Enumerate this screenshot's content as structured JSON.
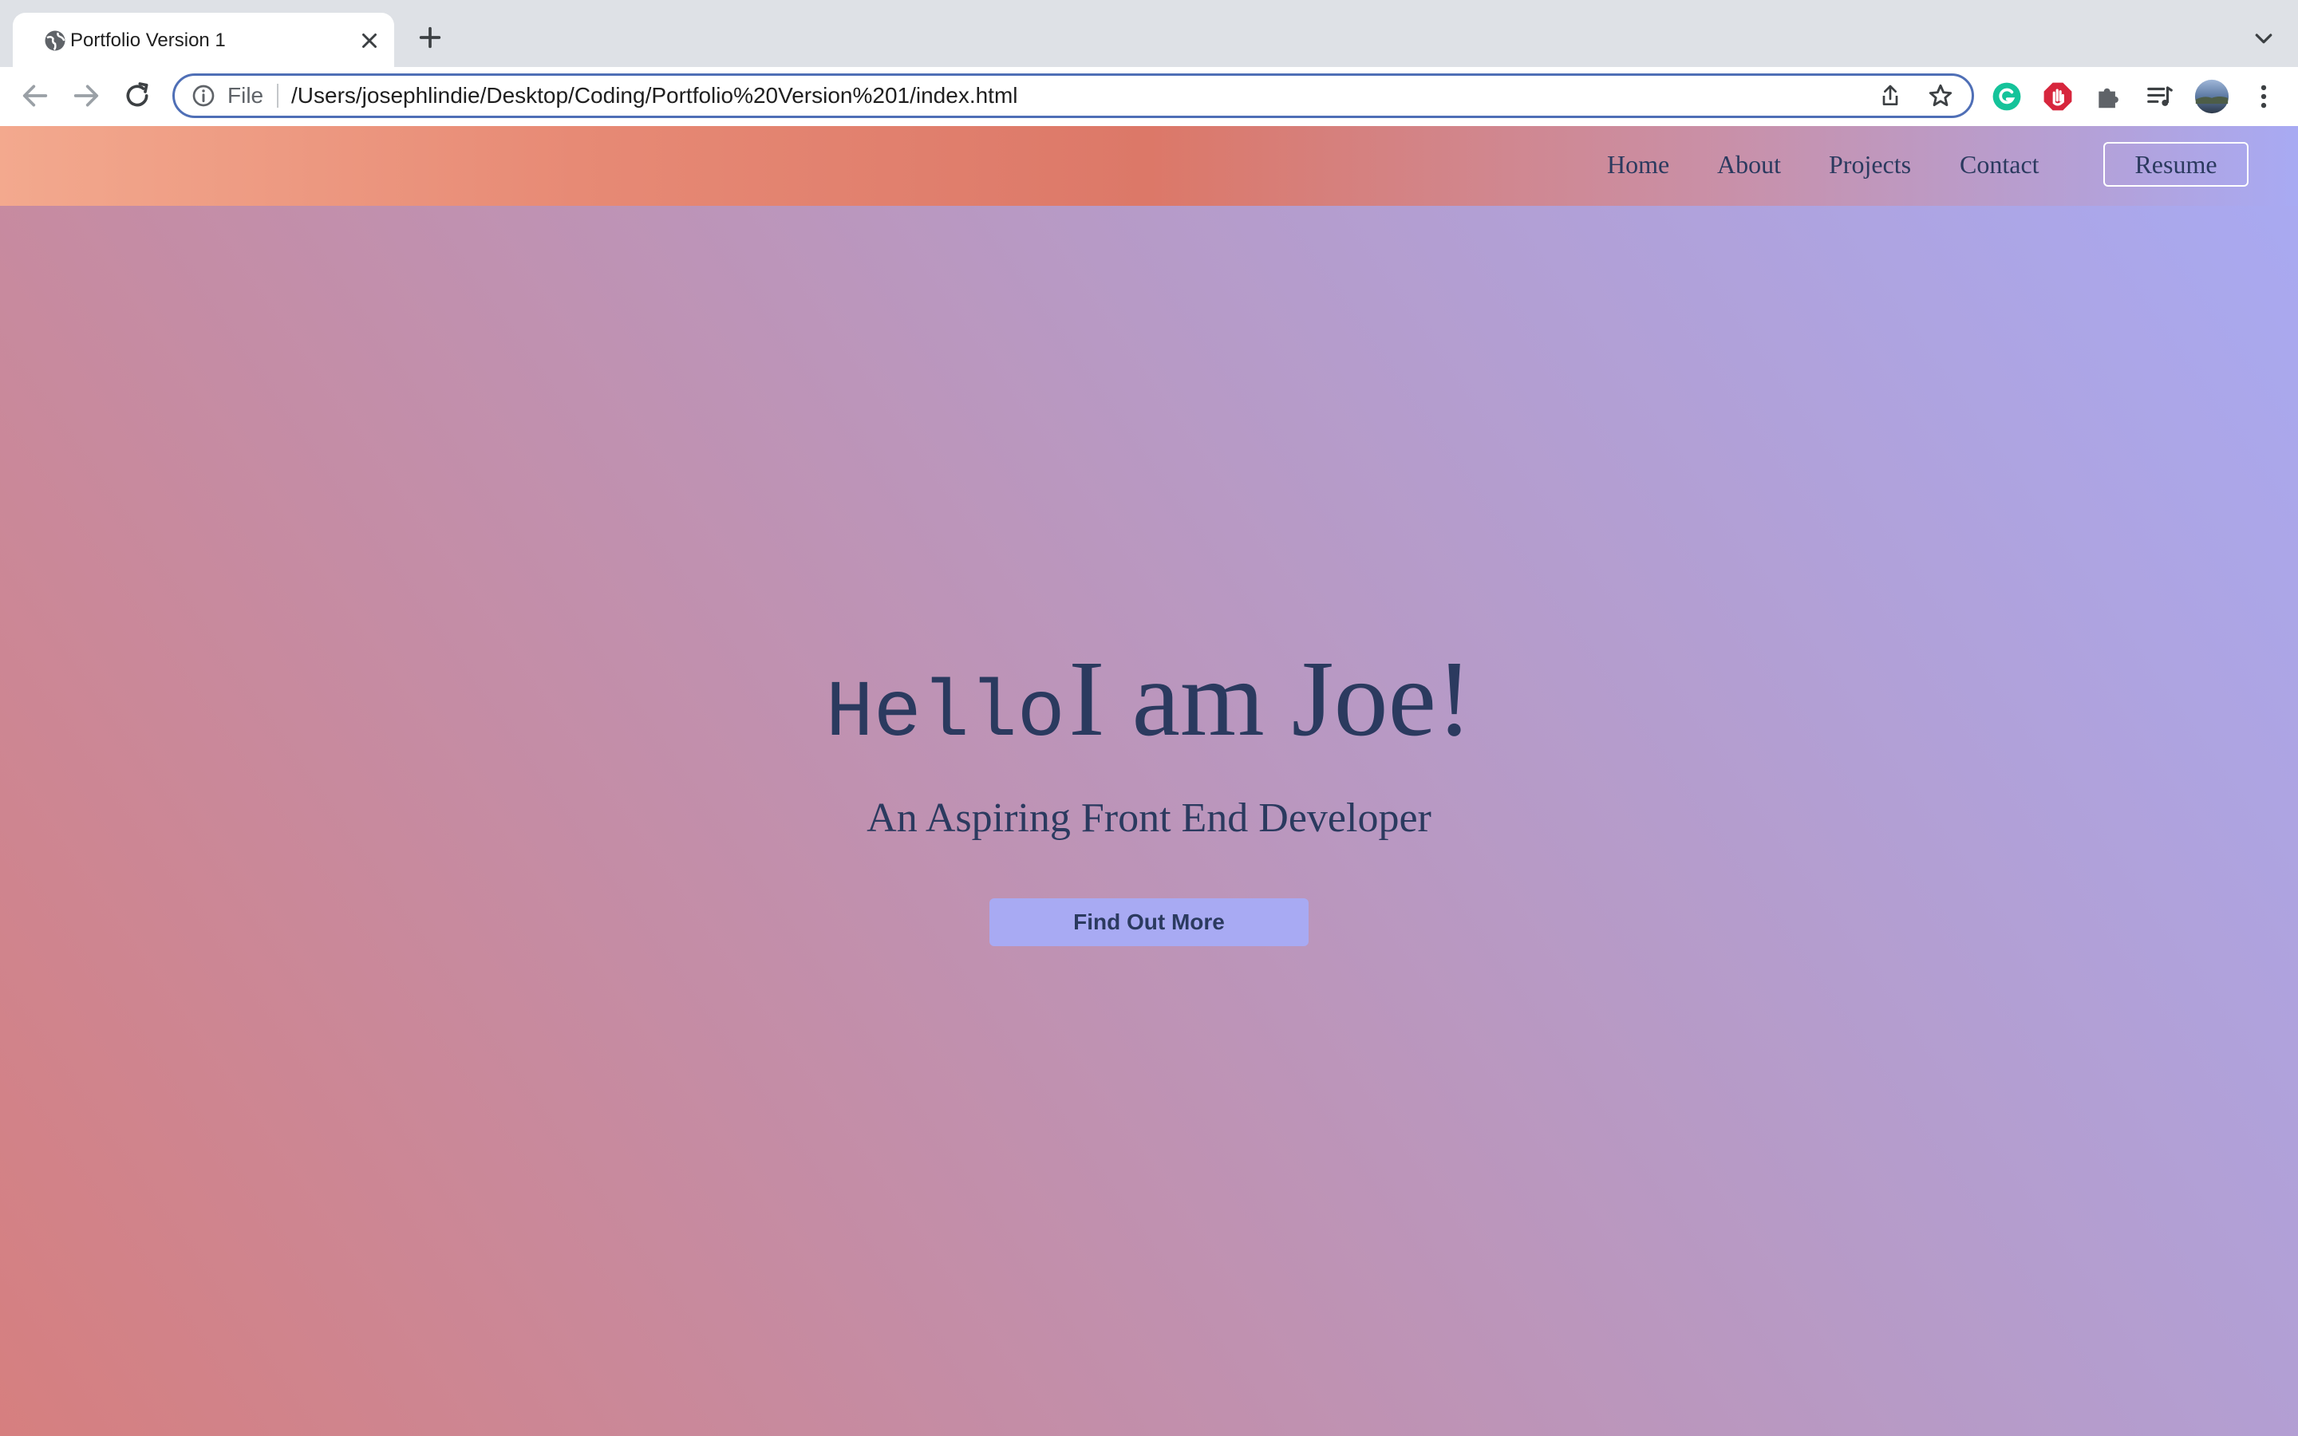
{
  "browser": {
    "tab_title": "Portfolio Version 1",
    "address_scheme_label": "File",
    "address_url": "/Users/josephlindie/Desktop/Coding/Portfolio%20Version%201/index.html",
    "icons": {
      "favicon": "globe-icon",
      "tab_close": "close-icon",
      "new_tab": "plus-icon",
      "tab_search": "chevron-down-icon",
      "back": "back-arrow-icon",
      "forward": "forward-arrow-icon",
      "reload": "reload-icon",
      "site_info": "info-icon",
      "share": "share-icon",
      "bookmark": "star-icon",
      "extensions": [
        "grammarly-icon",
        "adblock-icon",
        "puzzle-icon",
        "media-control-icon",
        "profile-avatar-icon",
        "kebab-menu-icon"
      ]
    }
  },
  "site": {
    "nav": {
      "items": [
        "Home",
        "About",
        "Projects",
        "Contact"
      ],
      "resume_label": "Resume"
    },
    "hero": {
      "greeting": "Hello",
      "headline": "I am Joe!",
      "subtitle": "An Aspiring Front End Developer",
      "cta_label": "Find Out More"
    },
    "colors": {
      "text": "#2b3a5f",
      "cta_background": "#a8aaf3",
      "gradient_warm": "#d67f7f",
      "gradient_cool": "#a8aaf3",
      "navbar_warm": "#f3a98e"
    }
  }
}
